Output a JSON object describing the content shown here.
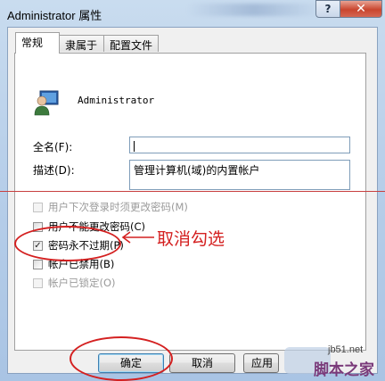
{
  "window": {
    "title": "Administrator 属性",
    "help_label": "?",
    "close_label": "✕"
  },
  "tabs": [
    {
      "label": "常规",
      "active": true
    },
    {
      "label": "隶属于",
      "active": false
    },
    {
      "label": "配置文件",
      "active": false
    }
  ],
  "user": {
    "name": "Administrator",
    "icon": "user-icon"
  },
  "fields": {
    "fullname_label": "全名(F):",
    "fullname_value": "",
    "description_label": "描述(D):",
    "description_value": "管理计算机(域)的内置帐户"
  },
  "checkboxes": [
    {
      "label": "用户下次登录时须更改密码(M)",
      "checked": false,
      "disabled": true
    },
    {
      "label": "用户不能更改密码(C)",
      "checked": false,
      "disabled": false
    },
    {
      "label": "密码永不过期(P)",
      "checked": true,
      "disabled": false
    },
    {
      "label": "帐户已禁用(B)",
      "checked": false,
      "disabled": false
    },
    {
      "label": "帐户已锁定(O)",
      "checked": false,
      "disabled": true
    }
  ],
  "buttons": {
    "ok": "确定",
    "cancel": "取消",
    "apply": "应用"
  },
  "annotation": {
    "text": "取消勾选",
    "color": "#d42020"
  },
  "watermark": {
    "url": "jb51.net",
    "site": "脚本之家"
  }
}
